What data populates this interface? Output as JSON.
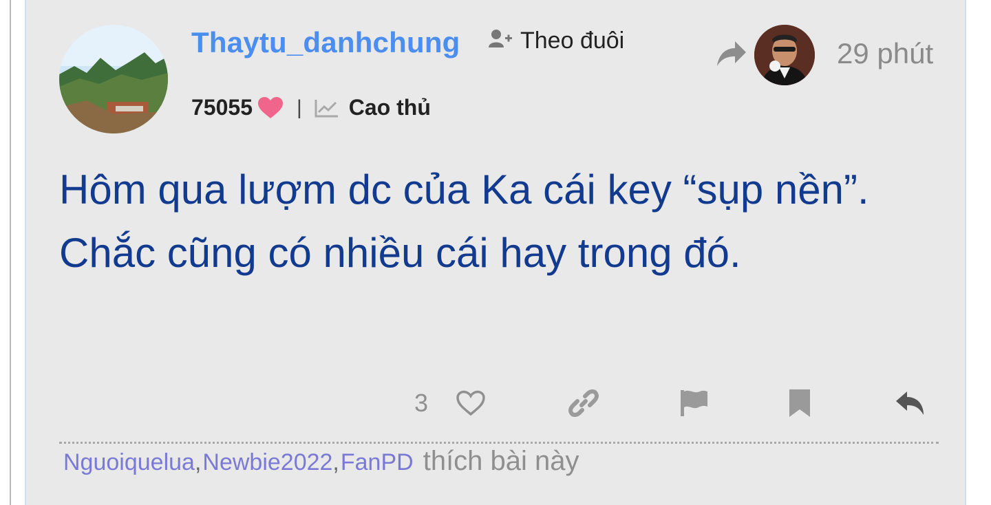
{
  "post": {
    "author": {
      "username": "Thaytu_danhchung",
      "points": "75055",
      "rank": "Cao thủ"
    },
    "follow_label": "Theo đuôi",
    "time": "29 phút",
    "content": {
      "line1": "Hôm qua lượm dc của Ka cái key “sụp nền”.",
      "line2": "Chắc cũng có nhiều cái hay trong đó."
    },
    "actions": {
      "like_count": "3"
    },
    "liked_by": {
      "users": [
        "Nguoiquelua",
        "Newbie2022",
        "FanPD"
      ],
      "suffix": "thích bài này"
    }
  },
  "icons": {
    "follow": "user-plus-icon",
    "heart": "heart-icon",
    "rank": "chart-line-icon",
    "share": "share-arrow-icon",
    "like": "heart-outline-icon",
    "link": "link-icon",
    "report": "flag-icon",
    "bookmark": "bookmark-icon",
    "reply": "reply-icon"
  },
  "colors": {
    "username": "#4b8ef0",
    "content": "#123a8f",
    "heart": "#f0658c",
    "liker": "#7a7ad6",
    "background": "#e9e9e9"
  }
}
